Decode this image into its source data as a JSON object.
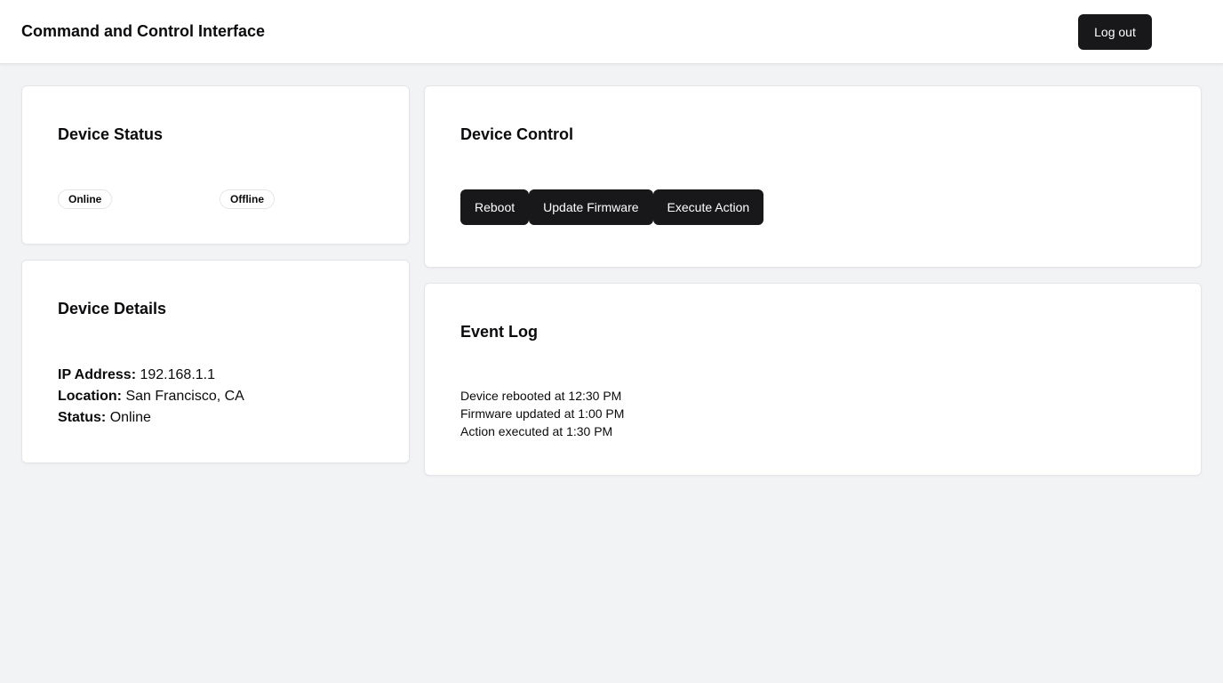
{
  "header": {
    "title": "Command and Control Interface",
    "logout_label": "Log out"
  },
  "device_status": {
    "title": "Device Status",
    "badges": [
      "Online",
      "Offline"
    ]
  },
  "device_details": {
    "title": "Device Details",
    "fields": [
      {
        "label": "IP Address:",
        "value": "192.168.1.1"
      },
      {
        "label": "Location:",
        "value": "San Francisco, CA"
      },
      {
        "label": "Status:",
        "value": "Online"
      }
    ]
  },
  "device_control": {
    "title": "Device Control",
    "buttons": [
      "Reboot",
      "Update Firmware",
      "Execute Action"
    ]
  },
  "event_log": {
    "title": "Event Log",
    "entries": [
      "Device rebooted at 12:30 PM",
      "Firmware updated at 1:00 PM",
      "Action executed at 1:30 PM"
    ]
  },
  "colors": {
    "page_background": "#f2f3f5",
    "card_background": "#ffffff",
    "button_background": "#18181b",
    "button_text": "#ffffff"
  }
}
